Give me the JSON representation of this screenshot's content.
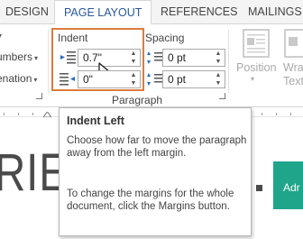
{
  "tabs": {
    "design": "DESIGN",
    "page_layout": "PAGE LAYOUT",
    "references": "REFERENCES",
    "mailings": "MAILINGS"
  },
  "ribbon": {
    "left_item_1": "umbers",
    "left_item_2": "enation",
    "indent": {
      "group_title": "Indent",
      "left_value": "0.7\"",
      "right_value": "0\""
    },
    "spacing": {
      "group_title": "Spacing",
      "before_value": "0 pt",
      "after_value": "0 pt"
    },
    "paragraph_group_label": "Paragraph",
    "position_label": "Position",
    "wrap_text_label_1": "Wra",
    "wrap_text_label_2": "Text"
  },
  "tooltip": {
    "title": "Indent Left",
    "body_1": "Choose how far to move the paragraph away from the left margin.",
    "body_2": "To change the margins for the whole document, click the Margins button."
  },
  "document": {
    "heading_fragment": "RIE",
    "heading_end": "",
    "green_button": "Adr"
  },
  "colors": {
    "accent_blue": "#2b579a",
    "highlight_orange": "#e07b39",
    "green": "#1fa58a"
  }
}
